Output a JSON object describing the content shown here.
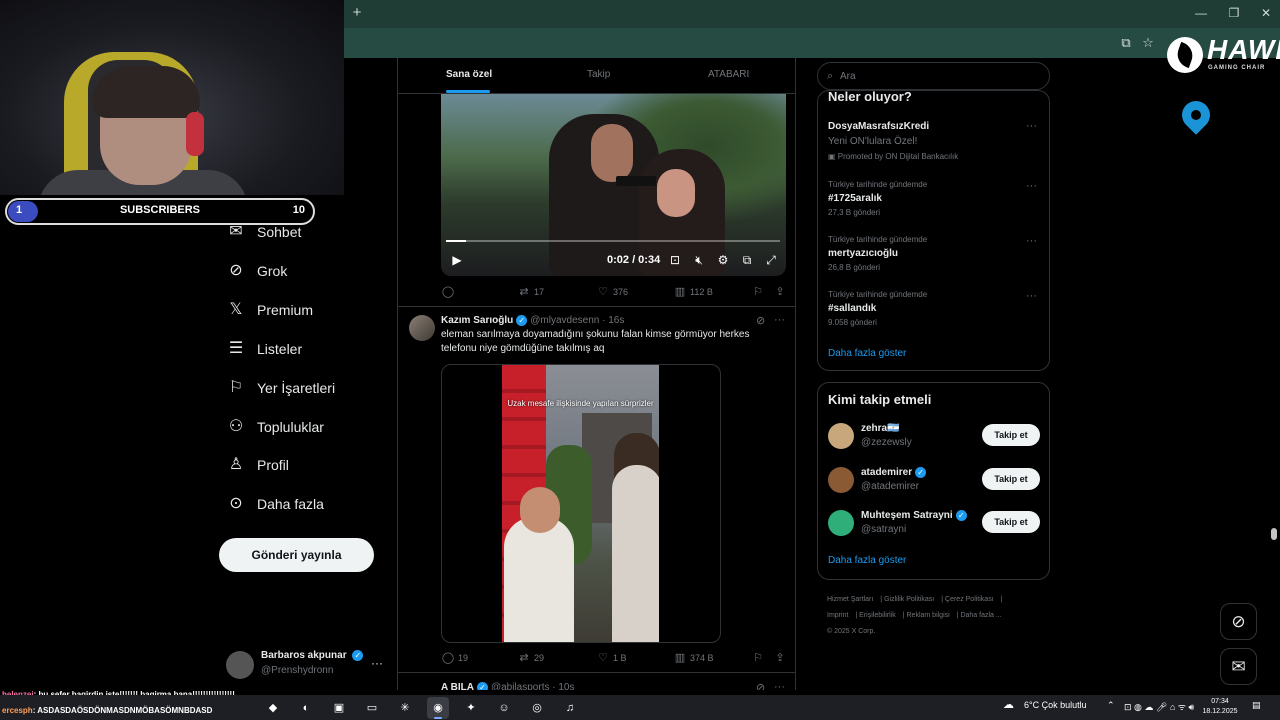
{
  "browser": {
    "new_tab_icon": "plus-icon",
    "window_controls": [
      "—",
      "❐",
      "✕"
    ]
  },
  "stream_overlay": {
    "subscribers": {
      "current": "1",
      "label": "SUBSCRIBERS",
      "goal": "10",
      "progress": 0.1
    },
    "chat": [
      {
        "user": "helenzei",
        "message": ": bu sefer bagirdin iste!!!!!!! bagirma bana!!!!!!!!!!!!!!!!"
      },
      {
        "user": "ercesph",
        "message": ": ASDASDAÖSDÖNMASDNMÖBASÖMNBDASD"
      }
    ],
    "brand": {
      "name": "HAWK",
      "tagline": "GAMING CHAIR"
    }
  },
  "sidebar": {
    "items": [
      {
        "label": "Sohbet",
        "icon": "chat-icon"
      },
      {
        "label": "Grok",
        "icon": "grok-icon"
      },
      {
        "label": "Premium",
        "icon": "x-logo-icon"
      },
      {
        "label": "Listeler",
        "icon": "list-icon"
      },
      {
        "label": "Yer İşaretleri",
        "icon": "bookmark-icon"
      },
      {
        "label": "Topluluklar",
        "icon": "communities-icon"
      },
      {
        "label": "Profil",
        "icon": "profile-icon"
      },
      {
        "label": "Daha fazla",
        "icon": "more-circle-icon"
      }
    ],
    "post_button": "Gönderi yayınla",
    "account": {
      "name": "Barbaros akpunar",
      "handle": "@Prenshydronn"
    }
  },
  "feed": {
    "tabs": [
      "Sana özel",
      "Takip",
      "ATABARI"
    ],
    "active_tab": 0,
    "video1": {
      "time": "0:02 / 0:34",
      "progress": 0.06
    },
    "tweet1_actions": {
      "replies": "",
      "reposts": "17",
      "likes": "376",
      "views": "112 B"
    },
    "tweet2": {
      "name": "Kazım Sarıoğlu",
      "handle": "@mlyavdesenn · 16s",
      "text": "eleman sarılmaya doyamadığını şokunu falan kimse görmüyor herkes telefonu niye gömdüğüne takılmış aq",
      "video_caption": "Uzak mesafe ilişkisinde yapılan sürprizler",
      "actions": {
        "replies": "19",
        "reposts": "29",
        "likes": "1 B",
        "views": "374 B"
      }
    },
    "tweet3": {
      "name": "A BILA",
      "handle": "@abilasports · 10s"
    }
  },
  "right": {
    "search_placeholder": "Ara",
    "trends_title": "Neler oluyor?",
    "trends": [
      {
        "meta": "",
        "name": "DosyaMasrafsızKredi",
        "sub": "Yeni ON'lulara Özel!",
        "count": "Promoted by ON Dijital Bankacılık"
      },
      {
        "meta": "Türkiye tarihinde gündemde",
        "name": "#1725aralık",
        "count": "27,3 B gönderi"
      },
      {
        "meta": "Türkiye tarihinde gündemde",
        "name": "mertyazıcıoğlu",
        "count": "26,8 B gönderi"
      },
      {
        "meta": "Türkiye tarihinde gündemde",
        "name": "#sallandık",
        "count": "9.058 gönderi"
      }
    ],
    "show_more": "Daha fazla göster",
    "who_to_follow_title": "Kimi takip etmeli",
    "follow_button": "Takip et",
    "suggestions": [
      {
        "name": "zehra🇦🇷",
        "handle": "@zezewsly",
        "color": "#c9a77c"
      },
      {
        "name": "atademirer",
        "handle": "@atademirer",
        "color": "#8a5a35",
        "verified": true
      },
      {
        "name": "Muhteşem Satrayni",
        "handle": "@satrayni",
        "color": "#2fae7a",
        "verified": true
      }
    ],
    "footer": [
      "Hizmet Şartları",
      "Gizlilik Politikası",
      "Çerez Politikası",
      "Imprint",
      "Erişilebilirlik",
      "Reklam bilgisi",
      "Daha fazla ...",
      "© 2025 X Corp."
    ]
  },
  "taskbar": {
    "weather": "6°C  Çok bulutlu",
    "time": "07:34",
    "date": "18.12.2025"
  }
}
